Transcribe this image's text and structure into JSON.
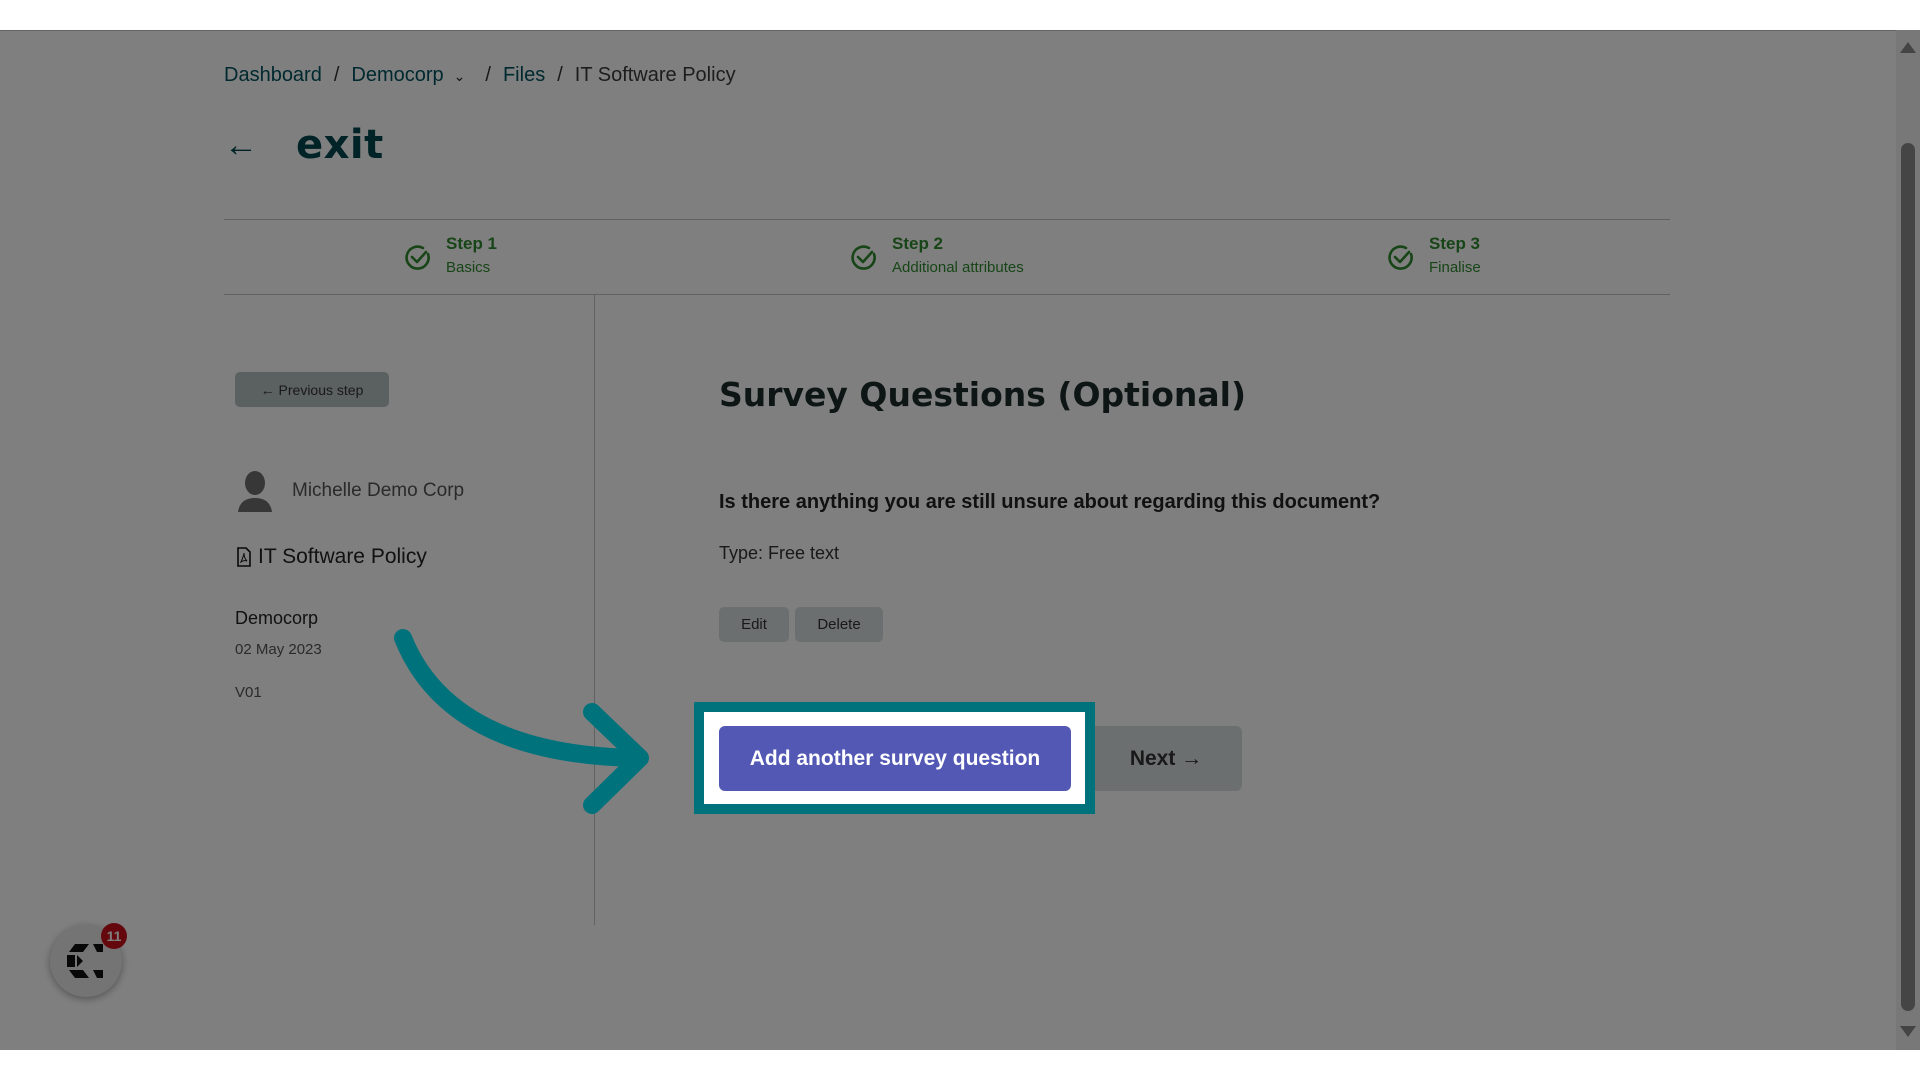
{
  "breadcrumb": {
    "items": [
      "Dashboard",
      "Democorp",
      "Files"
    ],
    "current": "IT Software Policy",
    "separator": "/"
  },
  "header": {
    "back_icon": "arrow-left-icon",
    "title": "exit"
  },
  "steps": [
    {
      "title": "Step 1",
      "subtitle": "Basics",
      "status": "complete"
    },
    {
      "title": "Step 2",
      "subtitle": "Additional attributes",
      "status": "complete"
    },
    {
      "title": "Step 3",
      "subtitle": "Finalise",
      "status": "complete"
    }
  ],
  "sidebar": {
    "previous_step_label": "← Previous step",
    "author_name": "Michelle Demo Corp",
    "document_name": "IT Software Policy",
    "organisation": "Democorp",
    "date": "02 May 2023",
    "version": "V01"
  },
  "main": {
    "title": "Survey Questions (Optional)",
    "questions": [
      {
        "text": "Is there anything you are still unsure about regarding this document?",
        "type_label": "Type: Free text"
      }
    ],
    "edit_label": "Edit",
    "delete_label": "Delete",
    "add_question_label": "Add another survey question",
    "next_label": "Next →"
  },
  "chat_widget": {
    "badge_count": "11"
  },
  "colors": {
    "brand_teal": "#00474f",
    "step_complete": "#2e8b2e",
    "primary_button": "#5358b5",
    "highlight_border": "#00727c",
    "badge": "#c8101a"
  }
}
